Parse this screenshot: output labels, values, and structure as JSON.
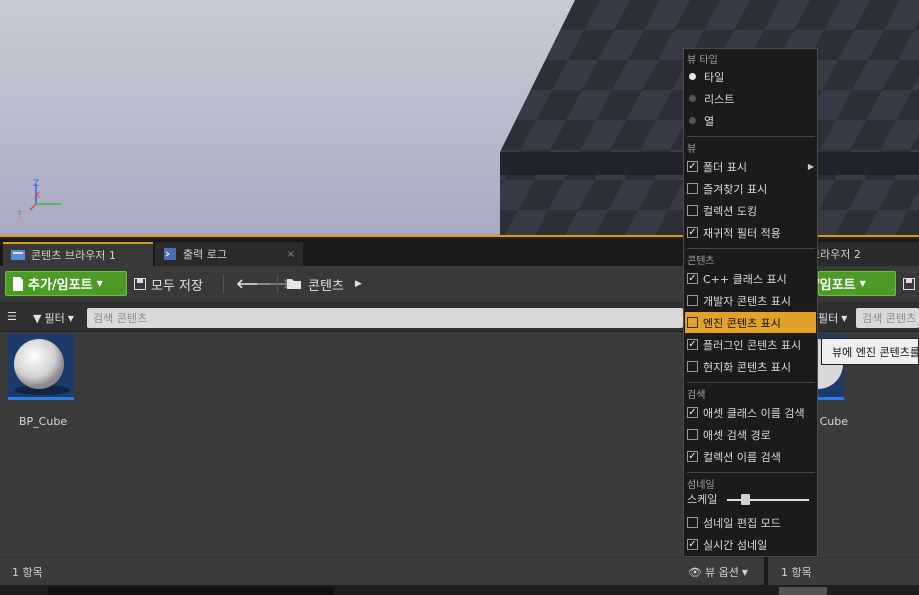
{
  "viewport": {
    "axes": {
      "x": "X",
      "y": "Y",
      "z": "Z"
    }
  },
  "tabs": [
    {
      "label": "콘텐츠 브라우저 1",
      "active": true,
      "close": "×"
    },
    {
      "label": "출력 로그",
      "active": false,
      "close": "×"
    },
    {
      "label": "콘텐츠 브라우저 2",
      "active": false
    }
  ],
  "toolbar": {
    "add_import": "추가/임포트",
    "save_all": "모두 저장",
    "breadcrumb": "콘텐츠",
    "add_import_right": "추가/임포트"
  },
  "filters": {
    "filter_label": "필터",
    "search_placeholder": "검색 콘텐츠",
    "filter_label_right": "필터",
    "search_placeholder_right": "검색 콘텐츠"
  },
  "assets": [
    {
      "name": "BP_Cube"
    }
  ],
  "assets_right": [
    {
      "name": "Cube"
    }
  ],
  "status": {
    "count_left": "1 항목",
    "count_right": "1 항목",
    "view_options": "뷰 옵션"
  },
  "menu": {
    "sections": {
      "view_type": "뷰 타입",
      "view": "뷰",
      "content": "콘텐츠",
      "search": "검색",
      "thumbnail": "섬네일"
    },
    "view_type_items": [
      {
        "label": "타일",
        "selected": true
      },
      {
        "label": "리스트",
        "selected": false
      },
      {
        "label": "열",
        "selected": false
      }
    ],
    "view_items": [
      {
        "label": "폴더 표시",
        "checked": true
      },
      {
        "label": "즐겨찾기 표시",
        "checked": false
      },
      {
        "label": "컬렉션 도킹",
        "checked": false
      },
      {
        "label": "재귀적 필터 적용",
        "checked": true
      }
    ],
    "content_items": [
      {
        "label": "C++ 클래스 표시",
        "checked": true
      },
      {
        "label": "개발자 콘텐츠 표시",
        "checked": false
      },
      {
        "label": "엔진 콘텐츠 표시",
        "checked": false
      },
      {
        "label": "플러그인 콘텐츠 표시",
        "checked": true
      },
      {
        "label": "현지화 콘텐츠 표시",
        "checked": false
      }
    ],
    "search_items": [
      {
        "label": "애셋 클래스 이름 검색",
        "checked": true
      },
      {
        "label": "애셋 검색 경로",
        "checked": false
      },
      {
        "label": "컬렉션 이름 검색",
        "checked": true
      }
    ],
    "scale_label": "스케일",
    "scale_value": 0.22,
    "thumbnail_items": [
      {
        "label": "섬네일 편집 모드",
        "checked": false
      },
      {
        "label": "실시간 섬네일",
        "checked": true
      }
    ]
  },
  "tooltip": {
    "text": "뷰에 엔진 콘텐츠를"
  },
  "colors": {
    "accent": "#d69a1e",
    "add_button": "#4e9a26",
    "menu_hover": "#e2a22a"
  }
}
